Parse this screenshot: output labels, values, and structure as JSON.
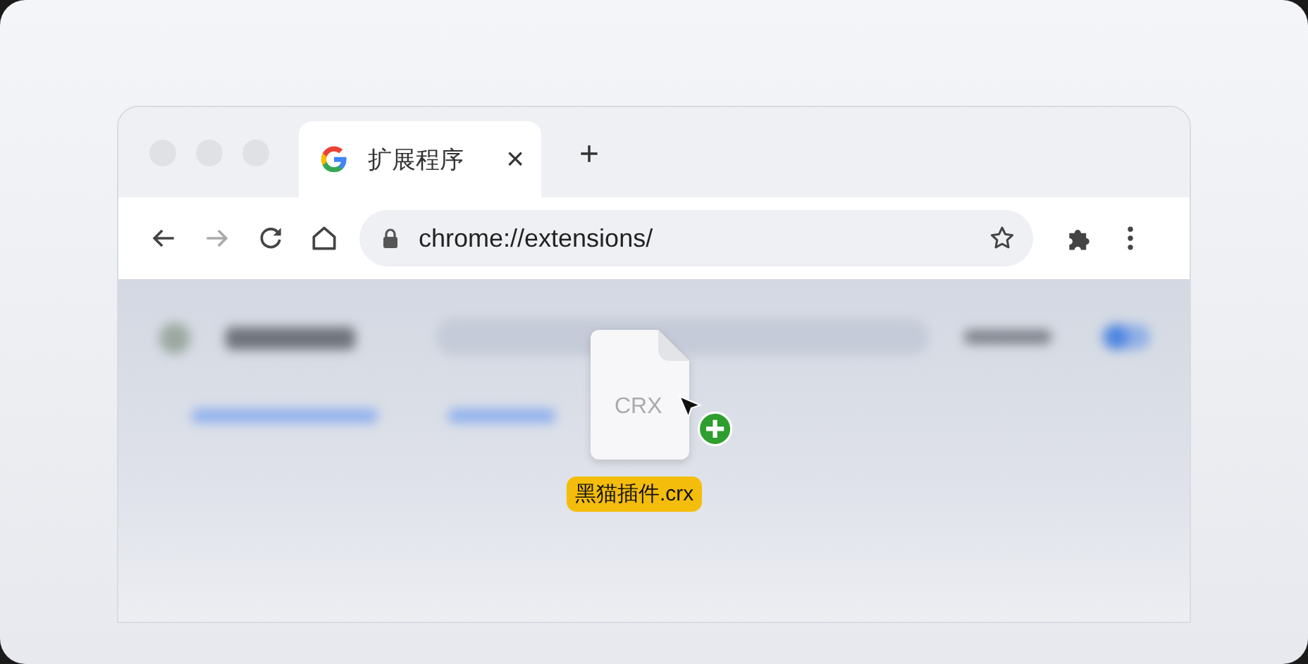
{
  "tab": {
    "title": "扩展程序",
    "close": "×",
    "selected": true
  },
  "new_tab": "+",
  "address_bar": {
    "url": "chrome://extensions/"
  },
  "drag_file": {
    "icon_label": "CRX",
    "filename": "黑猫插件.crx"
  }
}
